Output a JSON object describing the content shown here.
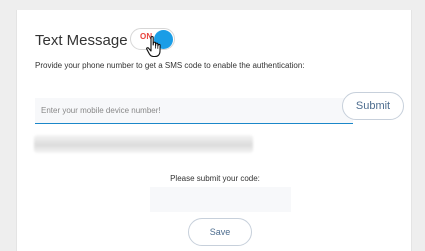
{
  "section": {
    "title": "Text Message",
    "toggle": {
      "label": "ON",
      "state": "on",
      "knob_color": "#1a9de6",
      "label_color": "#e8423b"
    },
    "description": "Provide your phone number to get a SMS code to enable the authentication:"
  },
  "phone": {
    "placeholder": "Enter your mobile device number!",
    "value": ""
  },
  "submit_button": {
    "label": "Submit"
  },
  "code": {
    "label": "Please submit your code:",
    "value": ""
  },
  "save_button": {
    "label": "Save"
  },
  "colors": {
    "accent": "#1a9de6",
    "input_underline": "#1b87c9",
    "button_text": "#4d6d8f"
  }
}
